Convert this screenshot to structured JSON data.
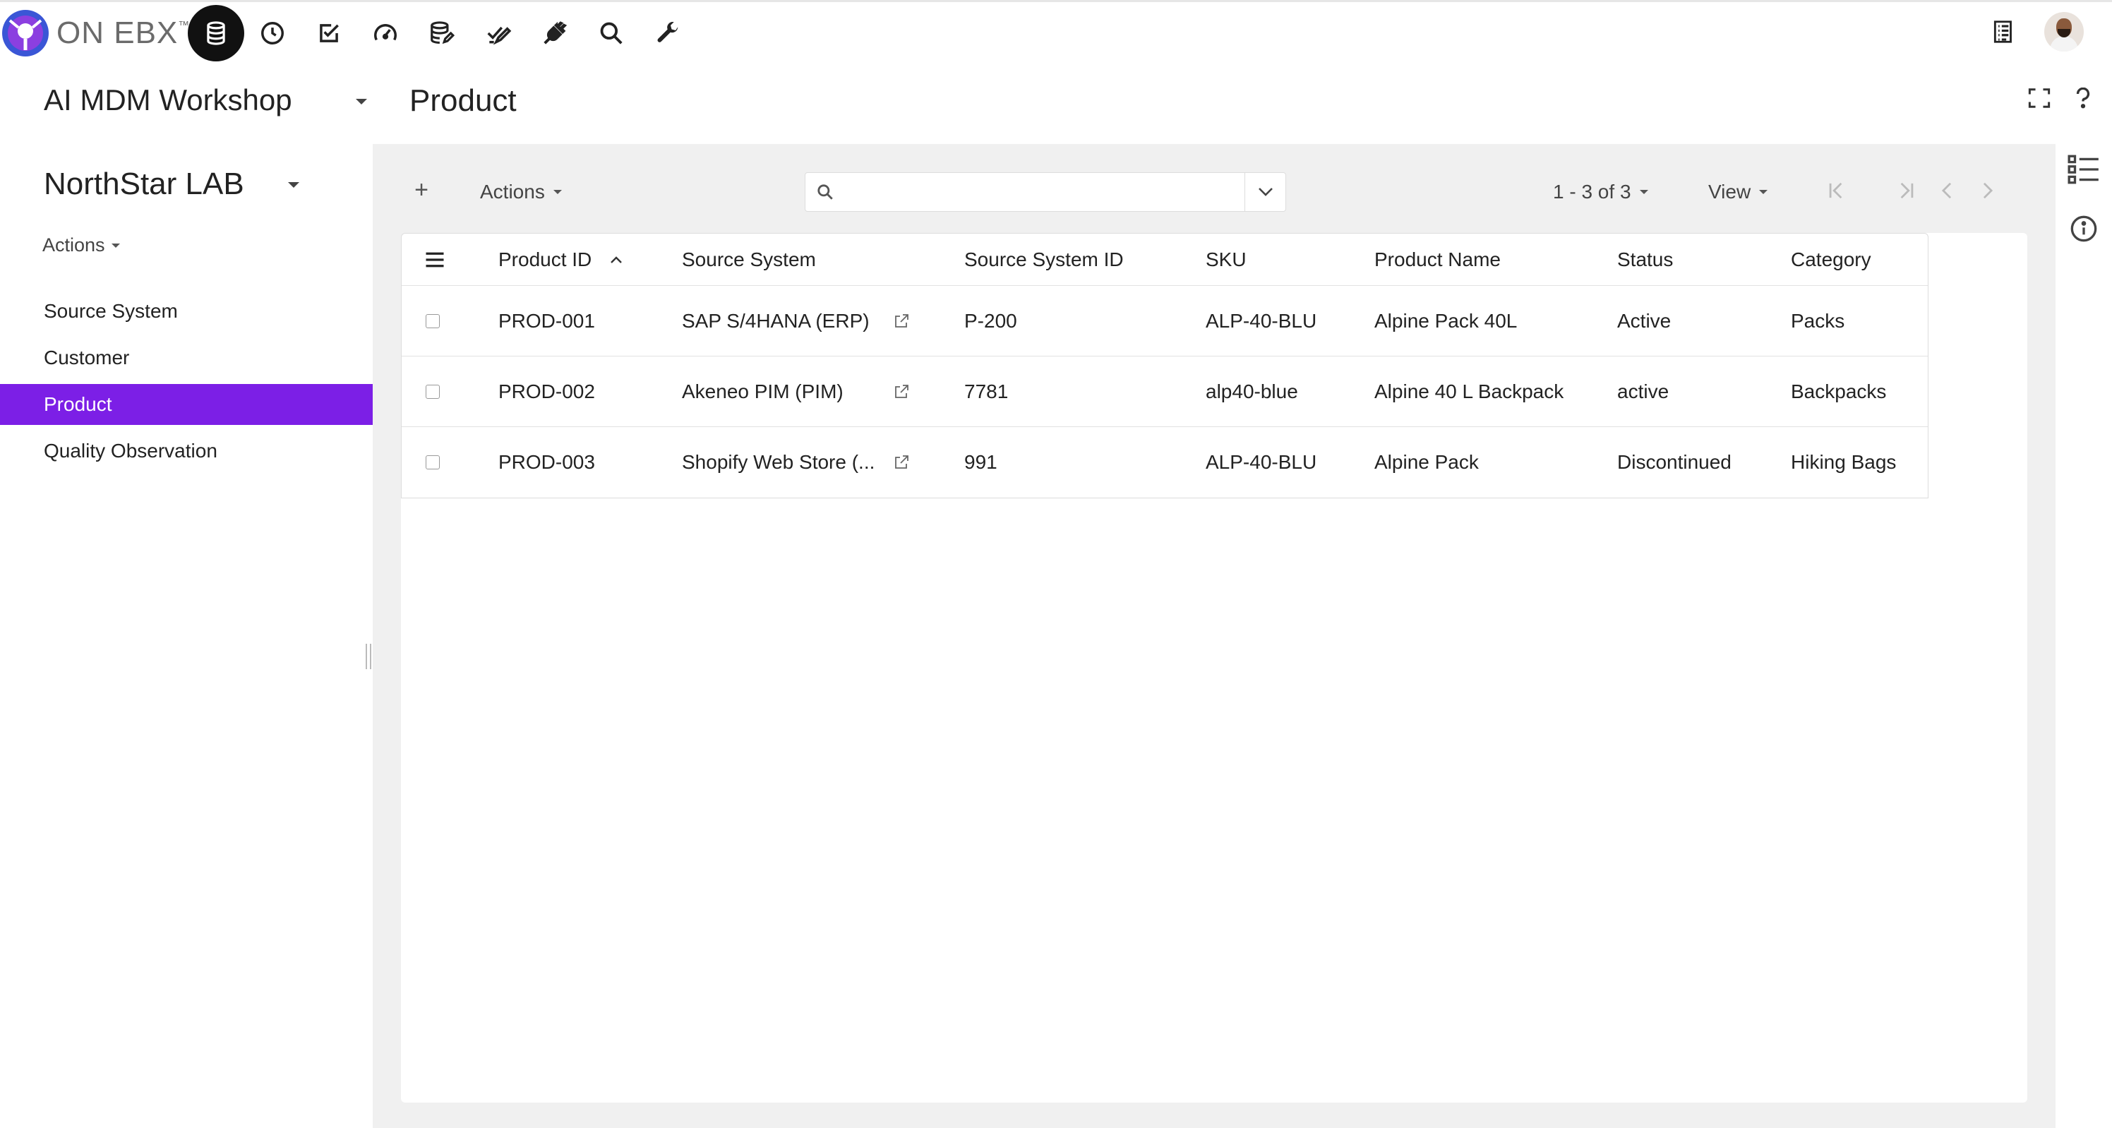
{
  "brand": {
    "name": "ON EBX",
    "tm": "™"
  },
  "topnav": {
    "icons": [
      "database-icon",
      "clock-icon",
      "task-check-icon",
      "dashboard-gauge-icon",
      "data-stack-edit-icon",
      "approval-check-icon",
      "plug-icon",
      "search-icon",
      "wrench-icon"
    ],
    "active": "database-icon"
  },
  "left": {
    "workspace_title": "AI MDM Workshop",
    "dataset_title": "NorthStar LAB",
    "actions_label": "Actions",
    "tree": [
      {
        "label": "Source System",
        "selected": false
      },
      {
        "label": "Customer",
        "selected": false
      },
      {
        "label": "Product",
        "selected": true
      },
      {
        "label": "Quality Observation",
        "selected": false
      }
    ]
  },
  "header": {
    "title": "Product"
  },
  "toolbar": {
    "add_label": "+",
    "actions_label": "Actions",
    "search_placeholder": "",
    "search_value": "",
    "count_label": "1 - 3 of 3",
    "view_label": "View"
  },
  "table": {
    "columns": [
      "Product ID",
      "Source System",
      "Source System ID",
      "SKU",
      "Product Name",
      "Status",
      "Category"
    ],
    "sorted_column": "Product ID",
    "sort_direction": "ascending",
    "rows": [
      {
        "product_id": "PROD-001",
        "source_system": "SAP S/4HANA (ERP)",
        "source_system_id": "P-200",
        "sku": "ALP-40-BLU",
        "product_name": "Alpine Pack 40L",
        "status": "Active",
        "category": "Packs"
      },
      {
        "product_id": "PROD-002",
        "source_system": "Akeneo PIM (PIM)",
        "source_system_id": "7781",
        "sku": "alp40-blue",
        "product_name": "Alpine 40 L Backpack",
        "status": "active",
        "category": "Backpacks"
      },
      {
        "product_id": "PROD-003",
        "source_system": "Shopify Web Store (...",
        "source_system_id": "991",
        "sku": "ALP-40-BLU",
        "product_name": "Alpine Pack",
        "status": "Discontinued",
        "category": "Hiking Bags"
      }
    ]
  },
  "colors": {
    "accent": "#7c1fe6",
    "logo_blue": "#2f5fd0",
    "logo_purple": "#8a3fe0",
    "background_main": "#f0f0f0"
  }
}
